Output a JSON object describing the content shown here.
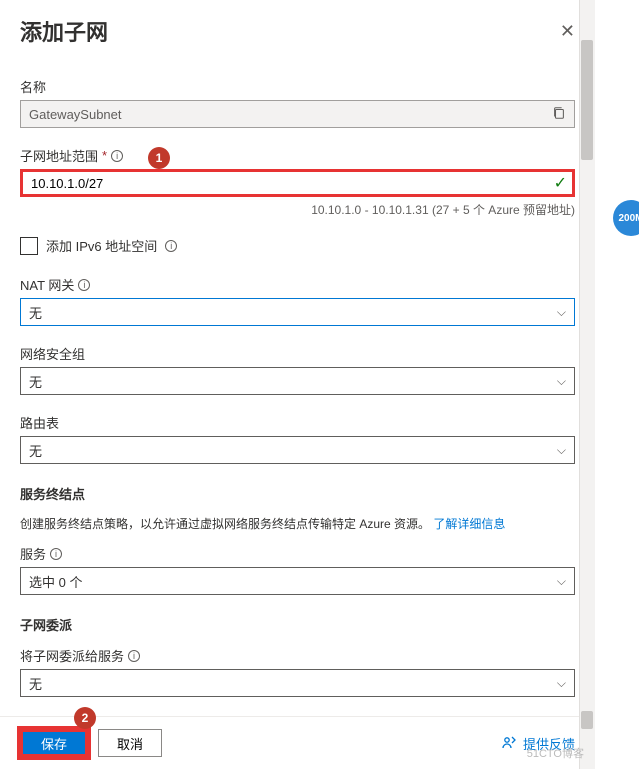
{
  "title": "添加子网",
  "fields": {
    "name": {
      "label": "名称",
      "value": "GatewaySubnet"
    },
    "addressRange": {
      "label": "子网地址范围",
      "value": "10.10.1.0/27",
      "helper": "10.10.1.0 - 10.10.1.31 (27 + 5 个 Azure 预留地址)"
    },
    "ipv6": {
      "label": "添加 IPv6 地址空间"
    },
    "natGateway": {
      "label": "NAT 网关",
      "value": "无"
    },
    "nsg": {
      "label": "网络安全组",
      "value": "无"
    },
    "routeTable": {
      "label": "路由表",
      "value": "无"
    }
  },
  "serviceEndpoints": {
    "header": "服务终结点",
    "helptext": "创建服务终结点策略，以允许通过虚拟网络服务终结点传输特定 Azure 资源。",
    "learnMore": "了解详细信息",
    "servicesLabel": "服务",
    "servicesValue": "选中 0 个"
  },
  "delegation": {
    "header": "子网委派",
    "label": "将子网委派给服务",
    "value": "无"
  },
  "footer": {
    "save": "保存",
    "cancel": "取消",
    "feedback": "提供反馈"
  },
  "annotations": {
    "badge1": "1",
    "badge2": "2",
    "badge200m": "200M"
  },
  "watermark": "51CTO博客"
}
